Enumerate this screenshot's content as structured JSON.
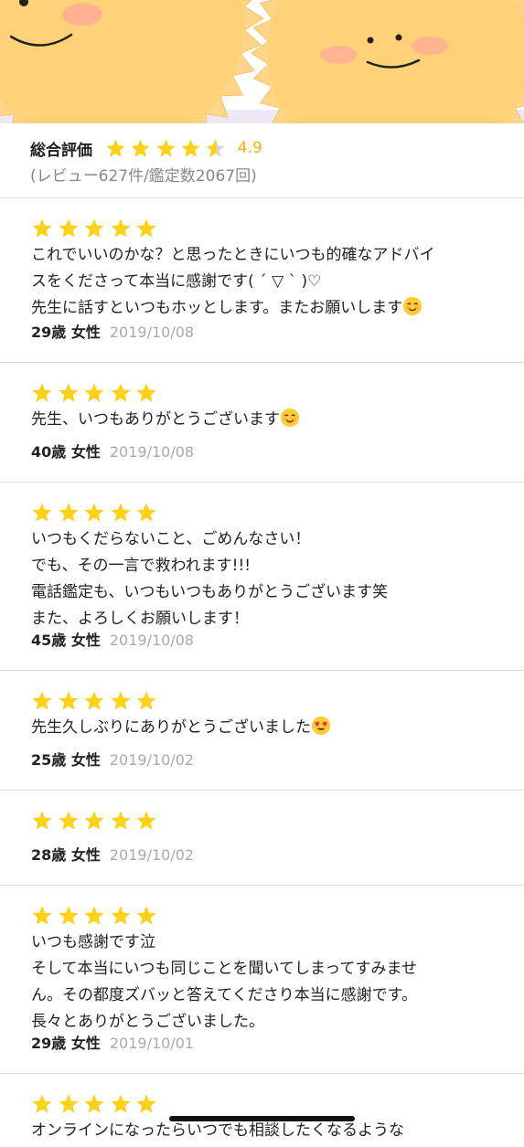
{
  "summary": {
    "label": "総合評価",
    "score": "4.9",
    "rating": 4.9,
    "counts": "(レビュー627件/鑑定数2067回)"
  },
  "colors": {
    "star": "#FCD116",
    "score": "#F5B400",
    "sun": "#FFD27A",
    "sun_edge": "#F7B64A"
  },
  "reviews": [
    {
      "stars": 5,
      "lines": [
        "これでいいのかな？と思ったときにいつも的確なアドバイ",
        "スをくださって本当に感謝です( ´ ▽ ` )♡",
        "先生に話すといつもホッとします。またお願いします"
      ],
      "emoji": "smiling-face",
      "age_gender": "29歳 女性",
      "date": "2019/10/08"
    },
    {
      "stars": 5,
      "lines": [
        "先生、いつもありがとうございます"
      ],
      "emoji": "smiling-face",
      "age_gender": "40歳 女性",
      "date": "2019/10/08"
    },
    {
      "stars": 5,
      "lines": [
        "いつもくだらないこと、ごめんなさい！",
        "でも、その一言で救われます!!!",
        "電話鑑定も、いつもいつもありがとうございます笑",
        "また、よろしくお願いします！"
      ],
      "emoji": "",
      "age_gender": "45歳 女性",
      "date": "2019/10/08"
    },
    {
      "stars": 5,
      "lines": [
        "先生久しぶりにありがとうございました"
      ],
      "emoji": "heart-eyes-face",
      "age_gender": "25歳 女性",
      "date": "2019/10/02"
    },
    {
      "stars": 5,
      "lines": [],
      "emoji": "",
      "age_gender": "28歳 女性",
      "date": "2019/10/02"
    },
    {
      "stars": 5,
      "lines": [
        "いつも感謝です泣",
        "そして本当にいつも同じことを聞いてしまってすみませ",
        "ん。その都度ズバッと答えてくださり本当に感謝です。",
        "長々とありがとうございました。"
      ],
      "emoji": "",
      "age_gender": "29歳 女性",
      "date": "2019/10/01"
    },
    {
      "stars": 5,
      "lines": [
        "オンラインになったらいつでも相談したくなるような"
      ],
      "emoji": "",
      "age_gender": "",
      "date": ""
    }
  ]
}
